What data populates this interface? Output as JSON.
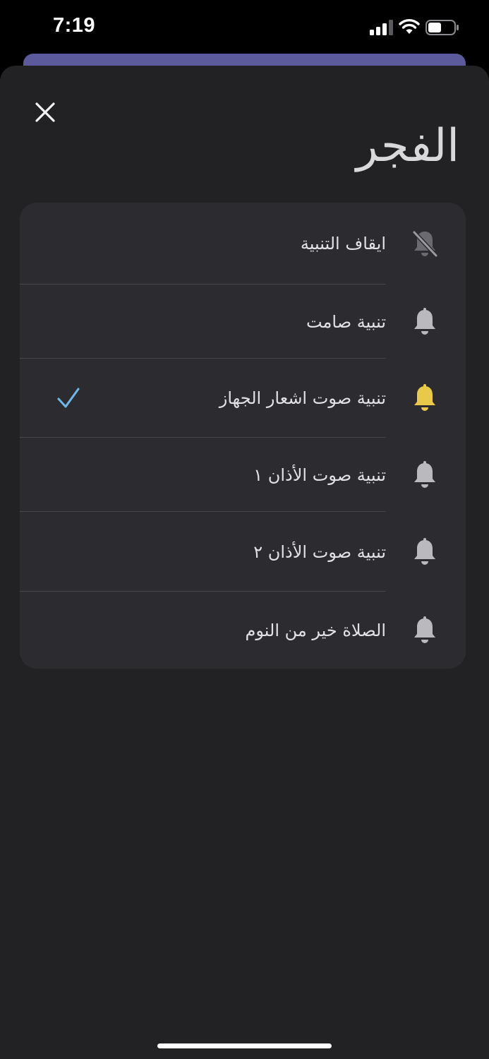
{
  "status_bar": {
    "time": "7:19"
  },
  "sheet": {
    "title": "الفجر",
    "options": [
      {
        "label": "ايقاف التنبية",
        "icon": "bell-slash-icon",
        "selected": false
      },
      {
        "label": "تنبية صامت",
        "icon": "bell-icon",
        "selected": false
      },
      {
        "label": "تنبية صوت اشعار الجهاز",
        "icon": "bell-icon",
        "selected": true
      },
      {
        "label": "تنبية صوت الأذان ١",
        "icon": "bell-icon",
        "selected": false
      },
      {
        "label": "تنبية صوت الأذان ٢",
        "icon": "bell-icon",
        "selected": false
      },
      {
        "label": "الصلاة خير من النوم",
        "icon": "bell-icon",
        "selected": false
      }
    ]
  },
  "colors": {
    "background": "#000000",
    "sheet": "#222224",
    "card": "#2c2c30",
    "behind_sheet": "#5c5a9c",
    "icon_default": "#b9b9be",
    "icon_active": "#e8c94a",
    "check": "#6fb8ea"
  }
}
